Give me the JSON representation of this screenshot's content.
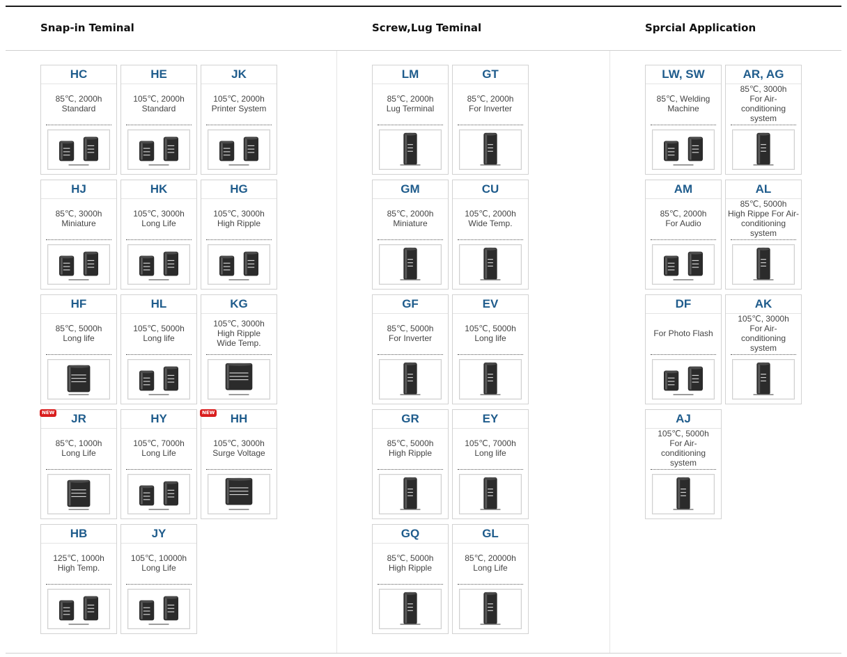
{
  "sections": [
    {
      "title": "Snap-in Teminal",
      "cards": [
        {
          "code": "HC",
          "lines": [
            "85℃, 2000h",
            "Standard"
          ],
          "img": "pair"
        },
        {
          "code": "HE",
          "lines": [
            "105℃, 2000h",
            "Standard"
          ],
          "img": "pair"
        },
        {
          "code": "JK",
          "lines": [
            "105℃, 2000h",
            "Printer System"
          ],
          "img": "pair"
        },
        {
          "code": "HJ",
          "lines": [
            "85℃, 3000h",
            "Miniature"
          ],
          "img": "pair"
        },
        {
          "code": "HK",
          "lines": [
            "105℃, 3000h",
            "Long Life"
          ],
          "img": "pair"
        },
        {
          "code": "HG",
          "lines": [
            "105℃, 3000h",
            "High Ripple"
          ],
          "img": "pair"
        },
        {
          "code": "HF",
          "lines": [
            "85℃, 5000h",
            "Long life"
          ],
          "img": "big"
        },
        {
          "code": "HL",
          "lines": [
            "105℃, 5000h",
            "Long life"
          ],
          "img": "pair"
        },
        {
          "code": "KG",
          "lines": [
            "105℃, 3000h",
            "High Ripple",
            "Wide Temp."
          ],
          "img": "wide"
        },
        {
          "code": "JR",
          "lines": [
            "85℃, 1000h",
            "Long Life"
          ],
          "img": "big",
          "badge": "NEW"
        },
        {
          "code": "HY",
          "lines": [
            "105℃, 7000h",
            "Long Life"
          ],
          "img": "pair"
        },
        {
          "code": "HH",
          "lines": [
            "105℃, 3000h",
            "Surge Voltage"
          ],
          "img": "wide",
          "badge": "NEW"
        },
        {
          "code": "HB",
          "lines": [
            "125℃, 1000h",
            "High Temp."
          ],
          "img": "pair"
        },
        {
          "code": "JY",
          "lines": [
            "105℃, 10000h",
            "Long Life"
          ],
          "img": "pair"
        }
      ]
    },
    {
      "title": "Screw,Lug Teminal",
      "cards": [
        {
          "code": "LM",
          "lines": [
            "85℃, 2000h",
            "Lug Terminal"
          ],
          "img": "tall"
        },
        {
          "code": "GT",
          "lines": [
            "85℃, 2000h",
            "For Inverter"
          ],
          "img": "tall"
        },
        {
          "code": "GM",
          "lines": [
            "85℃, 2000h",
            "Miniature"
          ],
          "img": "tall"
        },
        {
          "code": "CU",
          "lines": [
            "105℃, 2000h",
            "Wide Temp."
          ],
          "img": "tall"
        },
        {
          "code": "GF",
          "lines": [
            "85℃, 5000h",
            "For Inverter"
          ],
          "img": "tall"
        },
        {
          "code": "EV",
          "lines": [
            "105℃, 5000h",
            "Long life"
          ],
          "img": "tall"
        },
        {
          "code": "GR",
          "lines": [
            "85℃, 5000h",
            "High Ripple"
          ],
          "img": "tall"
        },
        {
          "code": "EY",
          "lines": [
            "105℃, 7000h",
            "Long life"
          ],
          "img": "tall"
        },
        {
          "code": "GQ",
          "lines": [
            "85℃, 5000h",
            "High Ripple"
          ],
          "img": "tall"
        },
        {
          "code": "GL",
          "lines": [
            "85℃, 20000h",
            "Long Life"
          ],
          "img": "tall"
        }
      ]
    },
    {
      "title": "Sprcial Application",
      "cards": [
        {
          "code": "LW, SW",
          "lines": [
            "85℃, Welding",
            "Machine"
          ],
          "img": "pair"
        },
        {
          "code": "AR, AG",
          "lines": [
            "85℃, 3000h",
            "For Air-",
            "conditioning system"
          ],
          "img": "tall"
        },
        {
          "code": "AM",
          "lines": [
            "85℃, 2000h",
            "For Audio"
          ],
          "img": "pair"
        },
        {
          "code": "AL",
          "lines": [
            "85℃, 5000h",
            "High Rippe For Air-",
            "conditioning system"
          ],
          "img": "tall"
        },
        {
          "code": "DF",
          "lines": [
            "For Photo Flash"
          ],
          "img": "pair"
        },
        {
          "code": "AK",
          "lines": [
            "105℃, 3000h",
            "For Air-",
            "conditioning system"
          ],
          "img": "tall"
        },
        {
          "code": "AJ",
          "lines": [
            "105℃, 5000h",
            "For Air-",
            "conditioning system"
          ],
          "img": "tall"
        }
      ]
    }
  ]
}
